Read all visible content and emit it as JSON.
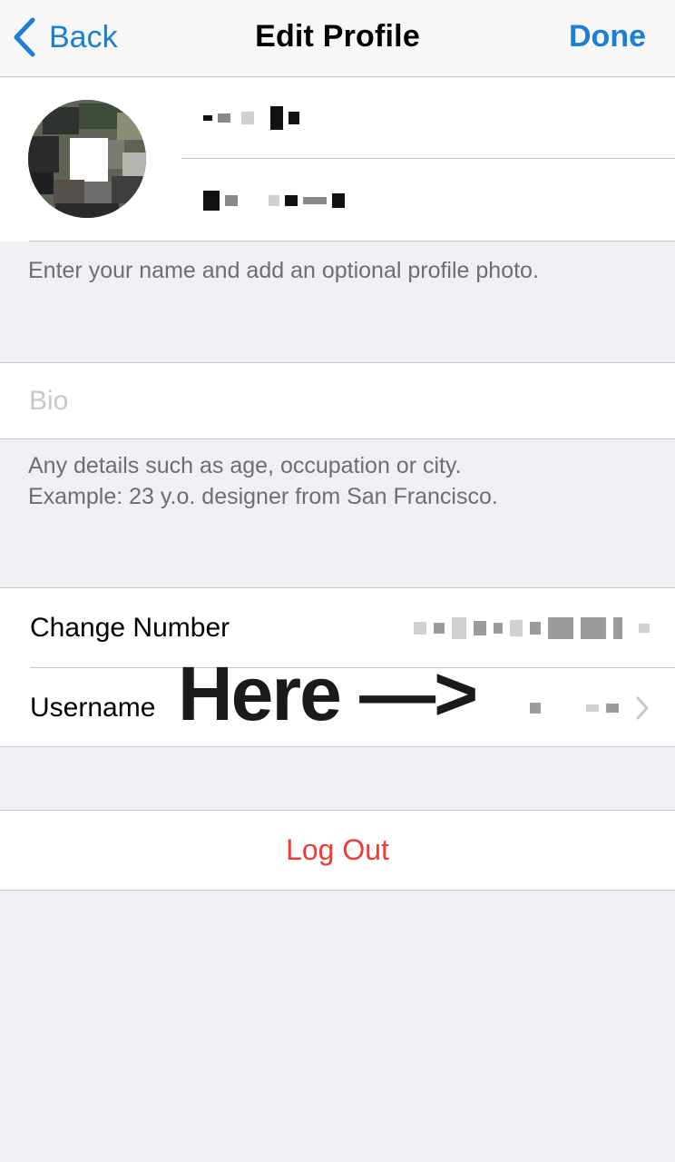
{
  "nav": {
    "back_label": "Back",
    "title": "Edit Profile",
    "done_label": "Done",
    "accent_color": "#1a7fd8"
  },
  "profile": {
    "first_name": "",
    "last_name": "",
    "hint": "Enter your name and add an optional profile photo."
  },
  "bio": {
    "placeholder": "Bio",
    "hint_line1": "Any details such as age, occupation or city.",
    "hint_line2": "Example: 23 y.o. designer from San Francisco."
  },
  "settings": {
    "change_number_label": "Change Number",
    "username_label": "Username"
  },
  "annotation": {
    "text": "Here —>"
  },
  "logout": {
    "label": "Log Out",
    "color": "#ee3b33"
  },
  "icons": [
    "chevron-left-icon",
    "chevron-right-icon"
  ]
}
